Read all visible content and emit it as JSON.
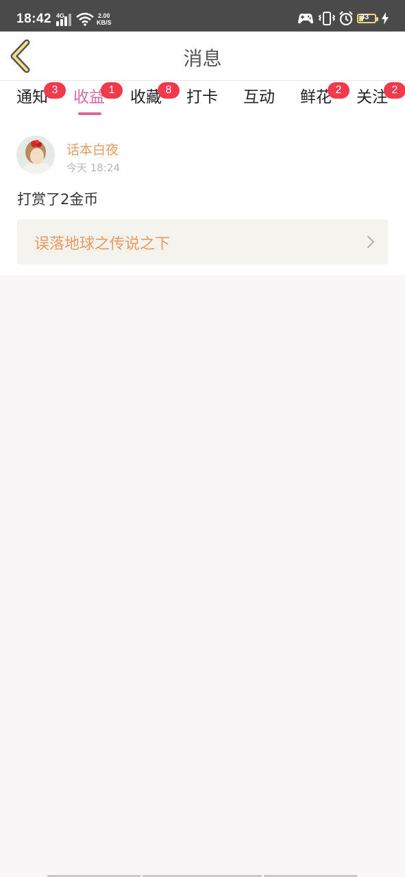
{
  "status_bar": {
    "time": "18:42",
    "network": "4G",
    "speed_value": "2.00",
    "speed_unit": "KB/S",
    "battery": "33"
  },
  "header": {
    "title": "消息"
  },
  "tabs": [
    {
      "label": "通知",
      "badge": "3",
      "active": false
    },
    {
      "label": "收益",
      "badge": "1",
      "active": true
    },
    {
      "label": "收藏",
      "badge": "8",
      "active": false
    },
    {
      "label": "打卡",
      "badge": "",
      "active": false
    },
    {
      "label": "互动",
      "badge": "",
      "active": false
    },
    {
      "label": "鲜花",
      "badge": "2",
      "active": false
    },
    {
      "label": "关注",
      "badge": "2",
      "active": false
    }
  ],
  "messages": [
    {
      "username": "话本白夜",
      "time": "今天 18:24",
      "content": "打赏了2金币",
      "book_title": "误落地球之传说之下"
    }
  ],
  "colors": {
    "accent": "#d66aa0",
    "username": "#e89a63",
    "badge": "#f23a4d",
    "status_bar": "#4a4a4a"
  }
}
